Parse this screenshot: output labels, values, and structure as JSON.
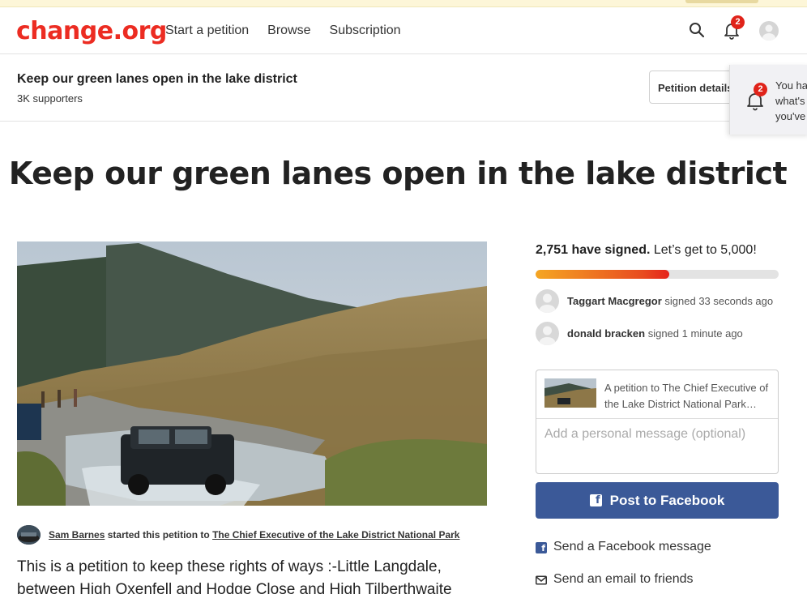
{
  "header": {
    "logo": "change.org",
    "nav": [
      "Start a petition",
      "Browse",
      "Subscription"
    ],
    "notification_count": "2"
  },
  "subbar": {
    "title": "Keep our green lanes open in the lake district",
    "supporters": "3K supporters",
    "details_button": "Petition details"
  },
  "notification_popup": {
    "badge": "2",
    "lines": [
      "You ha",
      "what's",
      "you've"
    ]
  },
  "petition": {
    "title": "Keep our green lanes open in the lake district",
    "starter_name": "Sam Barnes",
    "started_text": "started this petition to",
    "target": "The Chief Executive of the Lake District National Park",
    "body": "This is a petition to keep these rights of ways :-Little Langdale, between High Oxenfell and Hodge Close and High Tilberthwaite"
  },
  "signatures": {
    "count_text": "2,751 have signed.",
    "goal_text": "Let’s get to 5,000!",
    "progress_fraction": 0.5502,
    "recent": [
      {
        "name": "Taggart Macgregor",
        "action": "signed 33 seconds ago"
      },
      {
        "name": "donald bracken",
        "action": "signed 1 minute ago"
      }
    ]
  },
  "share": {
    "preview_title": "A petition to The Chief Executive of the Lake District National Park…",
    "message_placeholder": "Add a personal message (optional)",
    "facebook_button": "Post to Facebook",
    "links": [
      "Send a Facebook message",
      "Send an email to friends"
    ]
  },
  "colors": {
    "brand_red": "#ec2c22",
    "facebook_blue": "#3b5998",
    "badge_red": "#e0231a"
  }
}
